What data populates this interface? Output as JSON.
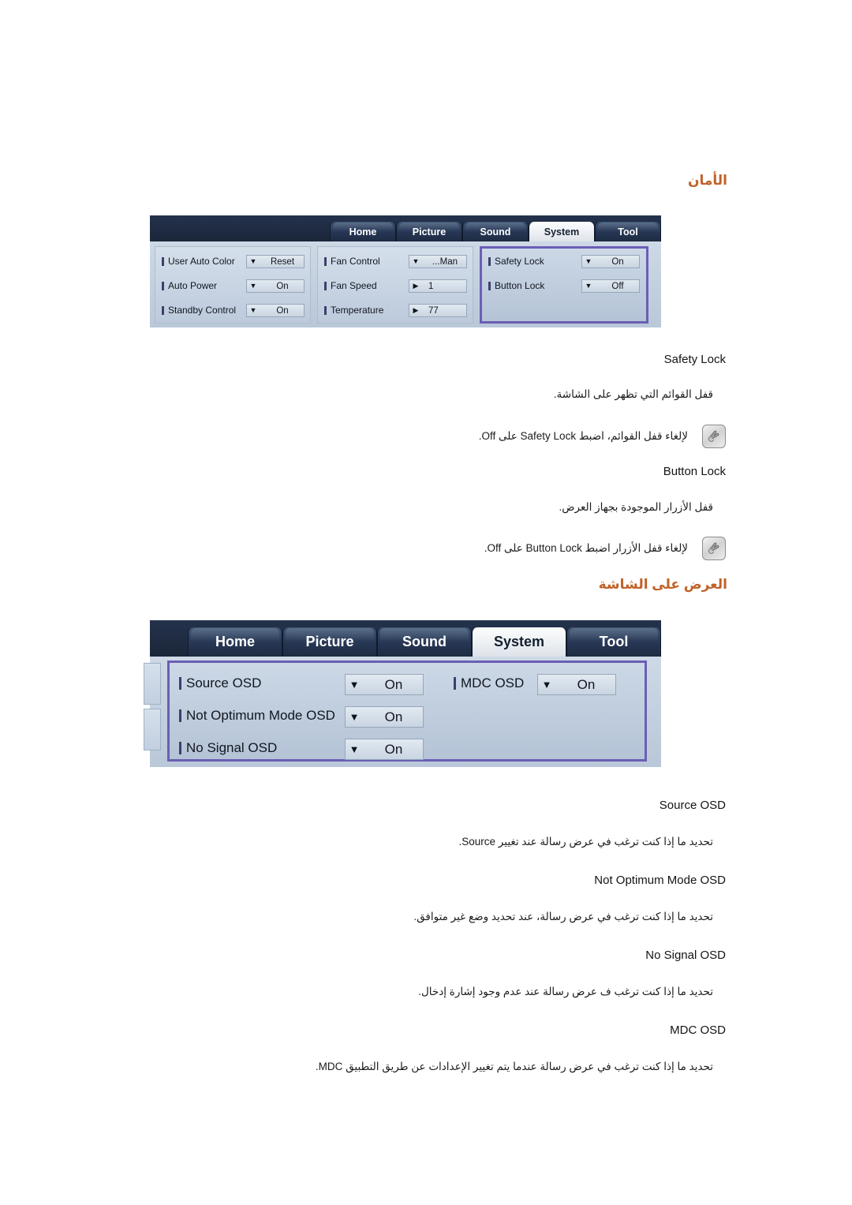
{
  "headings": {
    "security": "الأمان",
    "osd": "العرض على الشاشة"
  },
  "osd_panel_1": {
    "tabs": [
      {
        "label": "Home",
        "selected": false
      },
      {
        "label": "Picture",
        "selected": false
      },
      {
        "label": "Sound",
        "selected": false
      },
      {
        "label": "System",
        "selected": true
      },
      {
        "label": "Tool",
        "selected": false
      }
    ],
    "column_1": [
      {
        "label": "User Auto Color",
        "value": "Reset",
        "control": "dropdown"
      },
      {
        "label": "Auto Power",
        "value": "On",
        "control": "dropdown"
      },
      {
        "label": "Standby Control",
        "value": "On",
        "control": "dropdown"
      }
    ],
    "column_2": [
      {
        "label": "Fan Control",
        "value": "Man...",
        "control": "dropdown"
      },
      {
        "label": "Fan Speed",
        "value": "1",
        "control": "spinner"
      },
      {
        "label": "Temperature",
        "value": "77",
        "control": "spinner"
      }
    ],
    "column_3": [
      {
        "label": "Safety Lock",
        "value": "On",
        "control": "dropdown"
      },
      {
        "label": "Button Lock",
        "value": "Off",
        "control": "dropdown"
      }
    ],
    "highlight_color": "#6a5fb5"
  },
  "osd_panel_2": {
    "tabs": [
      {
        "label": "Home",
        "selected": false
      },
      {
        "label": "Picture",
        "selected": false
      },
      {
        "label": "Sound",
        "selected": false
      },
      {
        "label": "System",
        "selected": true
      },
      {
        "label": "Tool",
        "selected": false
      }
    ],
    "column_1": [
      {
        "label": "Source OSD",
        "value": "On",
        "control": "dropdown"
      },
      {
        "label": "Not Optimum Mode OSD",
        "value": "On",
        "control": "dropdown"
      },
      {
        "label": "No Signal OSD",
        "value": "On",
        "control": "dropdown"
      }
    ],
    "column_2": [
      {
        "label": "MDC OSD",
        "value": "On",
        "control": "dropdown"
      }
    ],
    "highlight_color": "#6a5fb5"
  },
  "security_section": {
    "safety_lock": {
      "term": "Safety Lock",
      "description": "قفل القوائم التي تظهر على الشاشة.",
      "note": "لإلغاء قفل القوائم، اضبط Safety Lock على Off."
    },
    "button_lock": {
      "term": "Button Lock",
      "description": "قفل الأزرار الموجودة بجهاز العرض.",
      "note": "لإلغاء قفل الأزرار اضبط Button Lock على Off."
    }
  },
  "osd_section": {
    "source_osd": {
      "term": "Source OSD",
      "description": "تحديد ما إذا كنت ترغب في عرض رسالة عند تغيير Source."
    },
    "not_optimum_mode_osd": {
      "term": "Not Optimum Mode OSD",
      "description": "تحديد ما إذا كنت ترغب في عرض رسالة، عند تحديد وضع غير متوافق."
    },
    "no_signal_osd": {
      "term": "No Signal OSD",
      "description": "تحديد ما إذا كنت ترغب ف عرض رسالة عند عدم وجود إشارة إدخال."
    },
    "mdc_osd": {
      "term": "MDC OSD",
      "description": "تحديد ما إذا كنت ترغب في عرض رسالة عندما يتم تغيير الإعدادات عن طريق التطبيق MDC."
    }
  },
  "icons": {
    "note_icon": "note-hand-icon",
    "dropdown_arrow": "▼",
    "spinner_arrow": "▶"
  }
}
